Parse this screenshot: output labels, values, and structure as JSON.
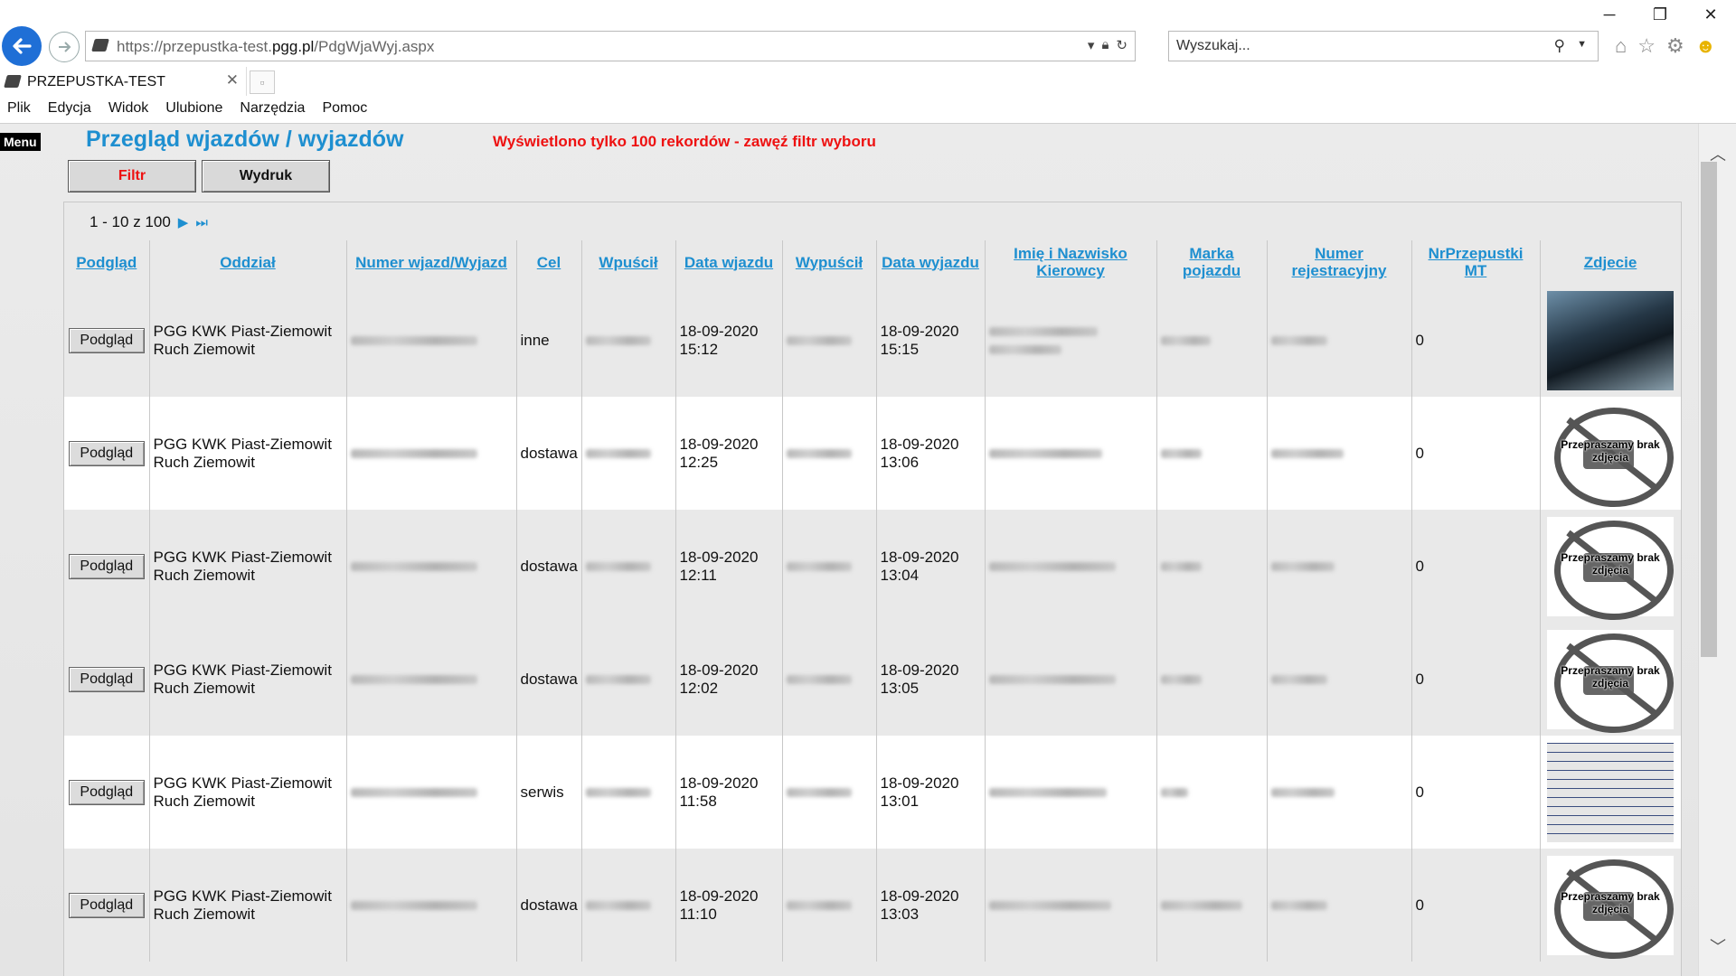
{
  "window": {
    "minimize": "─",
    "restore": "❐",
    "close": "✕"
  },
  "browser": {
    "url_prefix": "https://przepustka-test.",
    "url_domain": "pgg.pl",
    "url_path": "/PdgWjaWyj.aspx",
    "search_placeholder": "Wyszukaj...",
    "tab_label": "PRZEPUSTKA-TEST",
    "menu": [
      "Plik",
      "Edycja",
      "Widok",
      "Ulubione",
      "Narzędzia",
      "Pomoc"
    ]
  },
  "page": {
    "menu_tag": "Menu",
    "title": "Przegląd wjazdów / wyjazdów",
    "warning": "Wyświetlono tylko 100 rekordów - zawęź filtr wyboru",
    "filter_button": "Filtr",
    "print_button": "Wydruk",
    "pager": "1 - 10 z 100",
    "pager_next": "▶",
    "pager_last": "⏭"
  },
  "table": {
    "headers": [
      "Podgląd",
      "Oddział",
      "Numer wjazd/Wyjazd",
      "Cel",
      "Wpuścił",
      "Data wjazdu",
      "Wypuścił",
      "Data wyjazdu",
      "Imię i Nazwisko Kierowcy",
      "Marka pojazdu",
      "Numer rejestracyjny",
      "NrPrzepustki MT",
      "Zdjecie"
    ],
    "rows": [
      {
        "button": "Podgląd",
        "oddzial_1": "PGG KWK Piast-Ziemowit",
        "oddzial_2": "Ruch Ziemowit",
        "cel": "inne",
        "data_wjazdu_d": "18-09-2020",
        "data_wjazdu_t": "15:12",
        "data_wyjazdu_d": "18-09-2020",
        "data_wyjazdu_t": "15:15",
        "nr_mt": "0",
        "photo": "photo-phone"
      },
      {
        "button": "Podgląd",
        "oddzial_1": "PGG KWK Piast-Ziemowit",
        "oddzial_2": "Ruch Ziemowit",
        "cel": "dostawa",
        "data_wjazdu_d": "18-09-2020",
        "data_wjazdu_t": "12:25",
        "data_wyjazdu_d": "18-09-2020",
        "data_wyjazdu_t": "13:06",
        "nr_mt": "0",
        "photo": "no-photo"
      },
      {
        "button": "Podgląd",
        "oddzial_1": "PGG KWK Piast-Ziemowit",
        "oddzial_2": "Ruch Ziemowit",
        "cel": "dostawa",
        "data_wjazdu_d": "18-09-2020",
        "data_wjazdu_t": "12:11",
        "data_wyjazdu_d": "18-09-2020",
        "data_wyjazdu_t": "13:04",
        "nr_mt": "0",
        "photo": "no-photo"
      },
      {
        "button": "Podgląd",
        "oddzial_1": "PGG KWK Piast-Ziemowit",
        "oddzial_2": "Ruch Ziemowit",
        "cel": "dostawa",
        "data_wjazdu_d": "18-09-2020",
        "data_wjazdu_t": "12:02",
        "data_wyjazdu_d": "18-09-2020",
        "data_wyjazdu_t": "13:05",
        "nr_mt": "0",
        "photo": "no-photo"
      },
      {
        "button": "Podgląd",
        "oddzial_1": "PGG KWK Piast-Ziemowit",
        "oddzial_2": "Ruch Ziemowit",
        "cel": "serwis",
        "data_wjazdu_d": "18-09-2020",
        "data_wjazdu_t": "11:58",
        "data_wyjazdu_d": "18-09-2020",
        "data_wyjazdu_t": "13:01",
        "nr_mt": "0",
        "photo": "photo-document"
      },
      {
        "button": "Podgląd",
        "oddzial_1": "PGG KWK Piast-Ziemowit",
        "oddzial_2": "Ruch Ziemowit",
        "cel": "dostawa",
        "data_wjazdu_d": "18-09-2020",
        "data_wjazdu_t": "11:10",
        "data_wyjazdu_d": "18-09-2020",
        "data_wyjazdu_t": "13:03",
        "nr_mt": "0",
        "photo": "no-photo"
      }
    ],
    "no_photo_text": "Przepraszamy brak zdjęcia"
  },
  "colors": {
    "link_blue": "#1e8fd0",
    "warning_red": "#ee1111",
    "browser_back": "#1f6fd6"
  }
}
